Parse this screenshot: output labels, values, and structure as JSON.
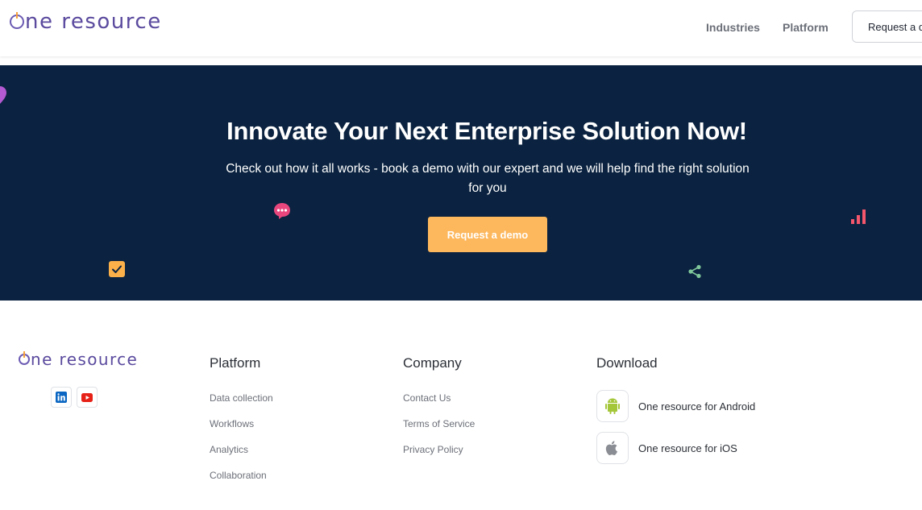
{
  "brand": {
    "name": "ne resource",
    "color": "#5b4a9e",
    "accent": "#f7a23b"
  },
  "header": {
    "nav": [
      {
        "label": "Industries"
      },
      {
        "label": "Platform"
      }
    ],
    "cta_label": "Request a demo"
  },
  "hero": {
    "title": "Innovate Your Next Enterprise Solution Now!",
    "subtitle": "Check out how it all works - book a demo with our expert and we will help find the right solution for you",
    "cta_label": "Request a demo",
    "background": "#0b2340",
    "cta_color": "#fdb75c",
    "decorations": [
      "heart-icon",
      "chat-bubble-icon",
      "bar-chart-icon",
      "checkbox-icon",
      "share-icon"
    ]
  },
  "footer": {
    "social": [
      {
        "icon": "linkedin-icon"
      },
      {
        "icon": "youtube-icon"
      }
    ],
    "platform": {
      "title": "Platform",
      "links": [
        "Data collection",
        "Workflows",
        "Analytics",
        "Collaboration"
      ]
    },
    "company": {
      "title": "Company",
      "links": [
        "Contact Us",
        "Terms of Service",
        "Privacy Policy"
      ]
    },
    "download": {
      "title": "Download",
      "apps": [
        {
          "label": "One resource for Android",
          "icon": "android-icon"
        },
        {
          "label": "One resource for iOS",
          "icon": "apple-icon"
        }
      ]
    }
  }
}
